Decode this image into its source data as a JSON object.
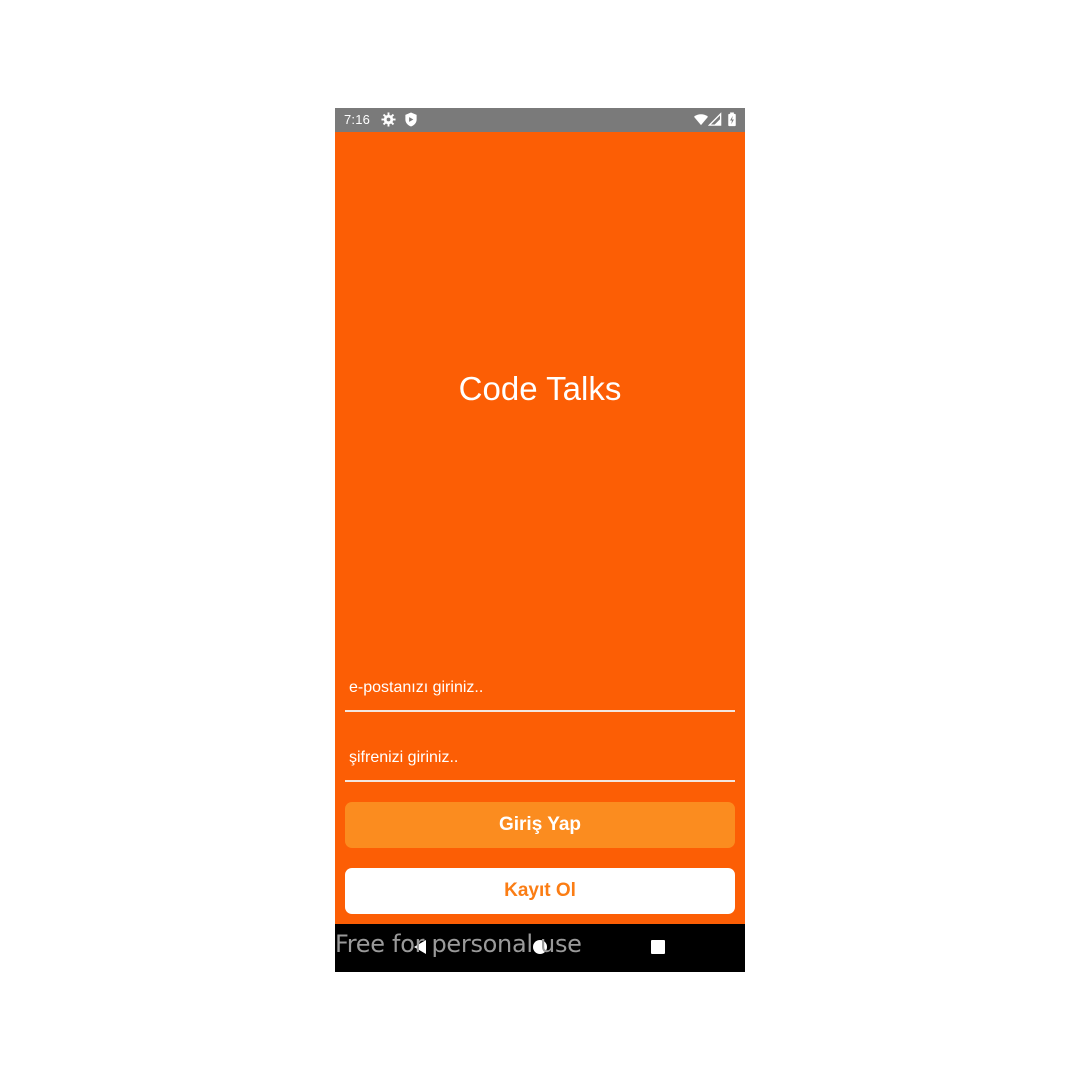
{
  "status_bar": {
    "time": "7:16",
    "icons": [
      "gear-icon",
      "shield-icon",
      "wifi-icon",
      "signal-icon",
      "battery-icon"
    ],
    "background": "#7a7a7a"
  },
  "app": {
    "title": "Code Talks",
    "background": "#fc5e05"
  },
  "form": {
    "email_placeholder": "e-postanızı giriniz..",
    "email_value": "",
    "password_placeholder": "şifrenizi giriniz..",
    "password_value": "",
    "login_label": "Giriş Yap",
    "register_label": "Kayıt Ol",
    "login_color": "#fb8c1f",
    "register_text_color": "#fb7d14"
  },
  "nav_bar": {
    "icons": [
      "back-icon",
      "home-icon",
      "recents-icon"
    ]
  },
  "watermark": {
    "text": "Free for personal use"
  }
}
